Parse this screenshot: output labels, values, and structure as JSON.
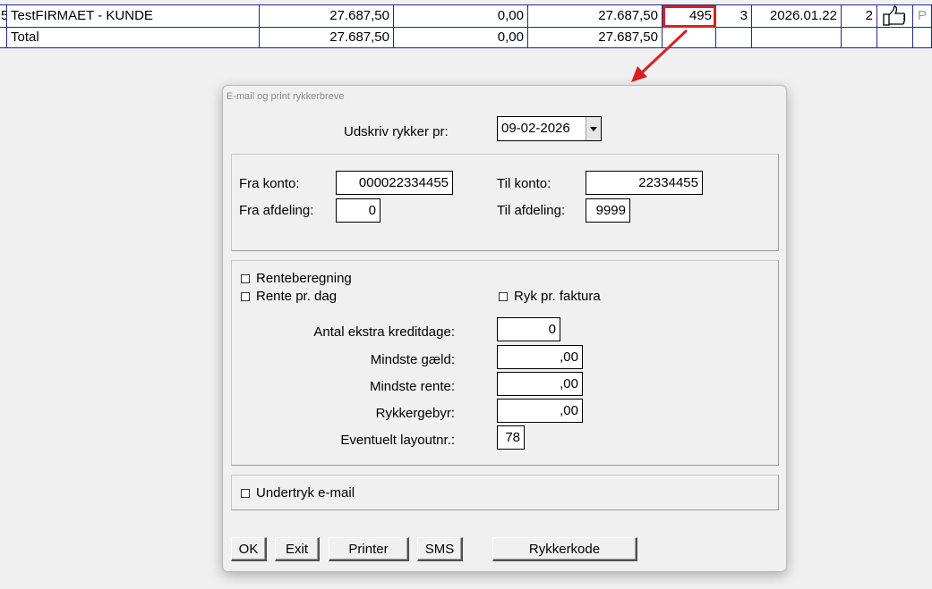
{
  "table": {
    "rows": [
      {
        "idx": "5",
        "name": "TestFIRMAET - KUNDE",
        "col1": "27.687,50",
        "col2": "0,00",
        "col3": "27.687,50",
        "col4": "495",
        "col5": "3",
        "date": "2026.01.22",
        "col7": "2",
        "flag": "P"
      },
      {
        "name": "Total",
        "col1": "27.687,50",
        "col2": "0,00",
        "col3": "27.687,50"
      }
    ]
  },
  "annotation": {
    "color": "#d82020"
  },
  "dialog": {
    "title": "E-mail og print rykkerbreve",
    "print_date_label": "Udskriv rykker pr:",
    "print_date_value": "09-02-2026",
    "range": {
      "from_account_label": "Fra konto:",
      "from_account_value": "000022334455",
      "to_account_label": "Til konto:",
      "to_account_value": "22334455",
      "from_dept_label": "Fra afdeling:",
      "from_dept_value": "0",
      "to_dept_label": "Til afdeling:",
      "to_dept_value": "9999"
    },
    "options": {
      "interest_calc_label": "Renteberegning",
      "interest_per_day_label": "Rente pr. dag",
      "per_invoice_label": "Ryk pr. faktura",
      "extra_credit_days_label": "Antal ekstra kreditdage:",
      "extra_credit_days_value": "0",
      "min_debt_label": "Mindste gæld:",
      "min_debt_value": ",00",
      "min_interest_label": "Mindste rente:",
      "min_interest_value": ",00",
      "fee_label": "Rykkergebyr:",
      "fee_value": ",00",
      "layout_label": "Eventuelt layoutnr.:",
      "layout_value": "78"
    },
    "suppress_email_label": "Undertryk e-mail",
    "buttons": {
      "ok": "OK",
      "exit": "Exit",
      "printer": "Printer",
      "sms": "SMS",
      "code": "Rykkerkode"
    }
  }
}
